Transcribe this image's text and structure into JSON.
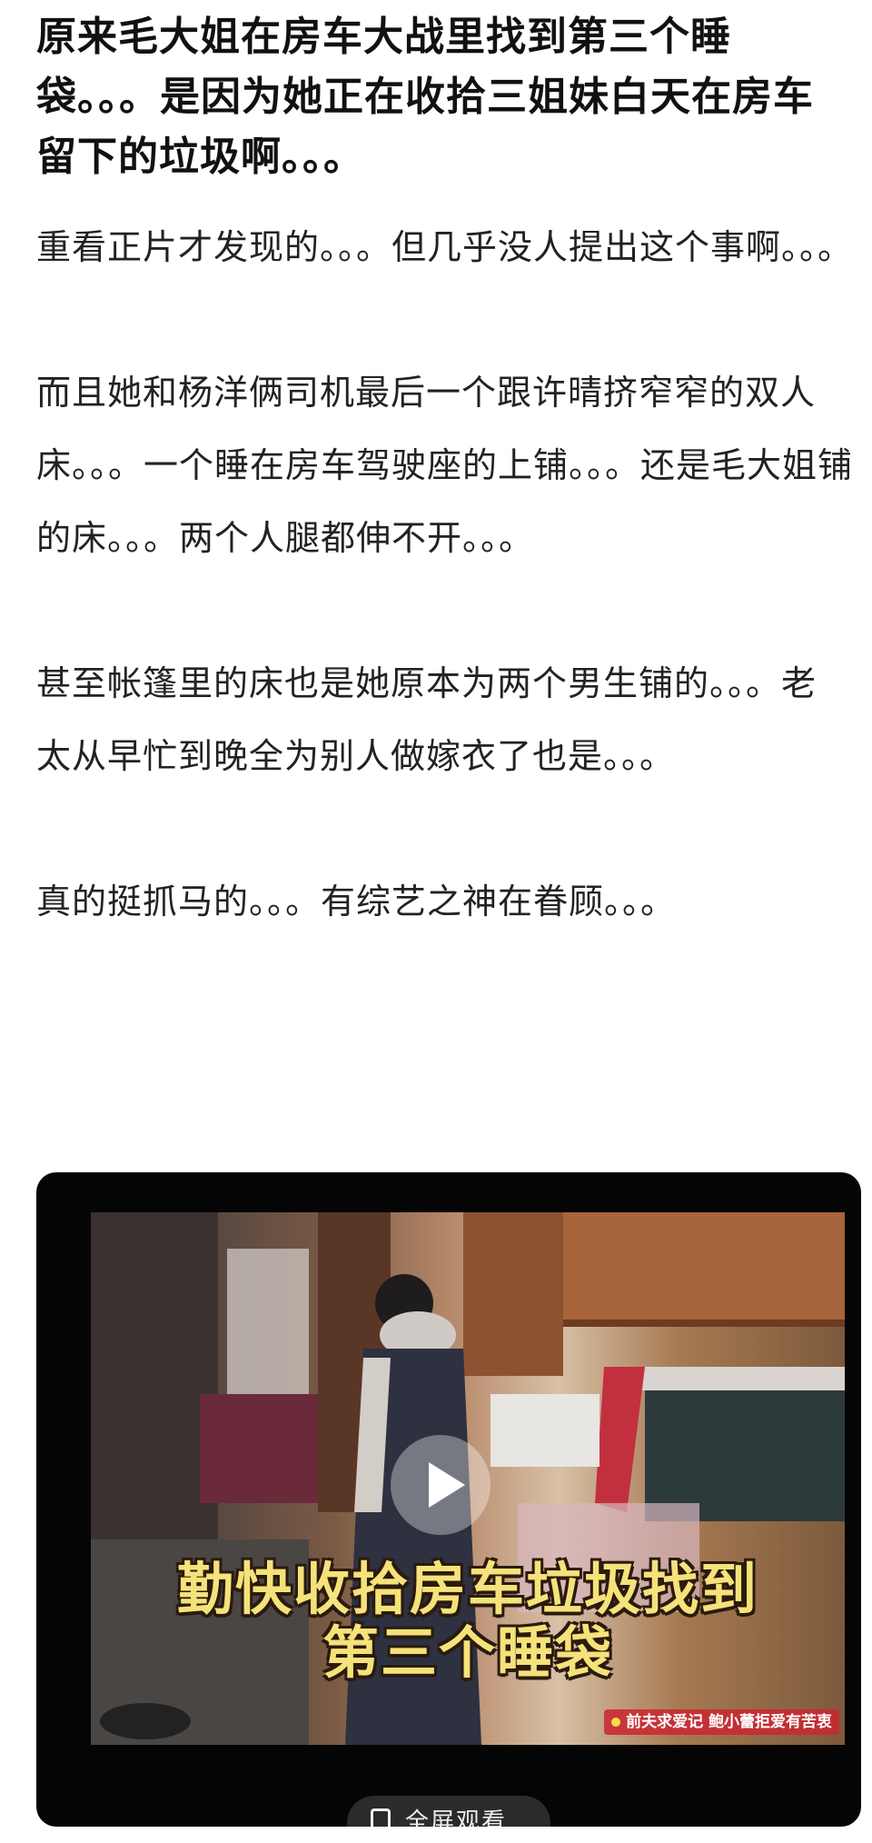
{
  "post": {
    "title": "原来毛大姐在房车大战里找到第三个睡袋。。。是因为她正在收拾三姐妹白天在房车留下的垃圾啊。。。",
    "paragraphs": [
      "重看正片才发现的。。。但几乎没人提出这个事啊。。。",
      "而且她和杨洋俩司机最后一个跟许晴挤窄窄的双人床。。。一个睡在房车驾驶座的上铺。。。还是毛大姐铺的床。。。两个人腿都伸不开。。。",
      "甚至帐篷里的床也是她原本为两个男生铺的。。。老太从早忙到晚全为别人做嫁衣了也是。。。",
      "真的挺抓马的。。。有综艺之神在眷顾。。。"
    ]
  },
  "video": {
    "subtitle_line1": "勤快收拾房车垃圾找到",
    "subtitle_line2": "第三个睡袋",
    "episode_tag": "前夫求爱记 鲍小蕾拒爱有苦衷",
    "fullscreen_label": "全屏观看",
    "icons": {
      "play": "play-icon",
      "fullscreen": "fullscreen-icon"
    }
  }
}
